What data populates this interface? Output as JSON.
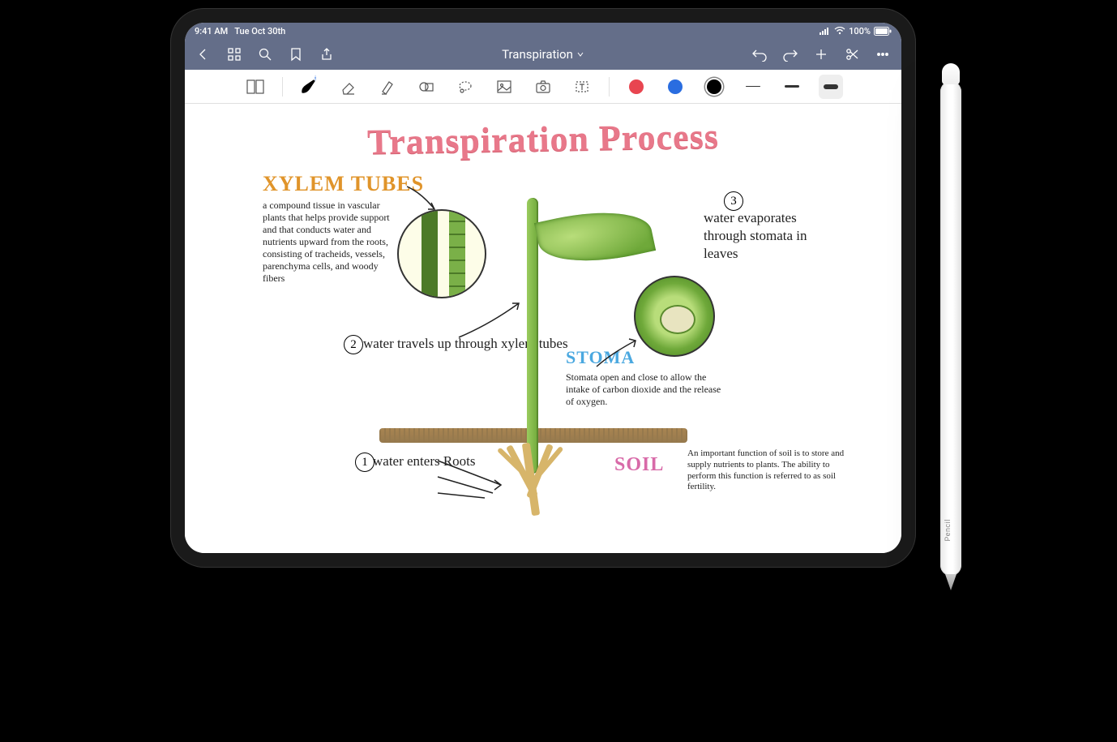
{
  "statusbar": {
    "time": "9:41 AM",
    "date": "Tue Oct 30th",
    "battery_pct": "100%"
  },
  "navbar": {
    "title": "Transpiration"
  },
  "toolbar": {
    "colors": [
      "#e84550",
      "#2a6de0",
      "#000000"
    ],
    "selected_color_index": 2,
    "thicknesses": [
      1,
      3,
      6
    ],
    "selected_thickness_index": 2
  },
  "canvas": {
    "title": "Transpiration Process",
    "sections": {
      "xylem": {
        "label": "XYLEM TUBES",
        "body": "a compound tissue in vascular plants that helps provide support and that conducts water and nutrients upward from the roots, consisting of tracheids, vessels, parenchyma cells, and woody fibers"
      },
      "stoma": {
        "label": "STOMA",
        "body": "Stomata open and close to allow the intake of carbon dioxide and the release of oxygen."
      },
      "soil": {
        "label": "SOIL",
        "body": "An important function of soil is to store and supply nutrients to plants. The ability to perform this function is referred to as soil fertility."
      }
    },
    "steps": {
      "s1_num": "1",
      "s1": "water enters Roots",
      "s2_num": "2",
      "s2": "water travels up through xylem tubes",
      "s3_num": "3",
      "s3": "water evaporates through stomata in leaves"
    }
  },
  "pencil": {
    "label": "Pencil"
  }
}
